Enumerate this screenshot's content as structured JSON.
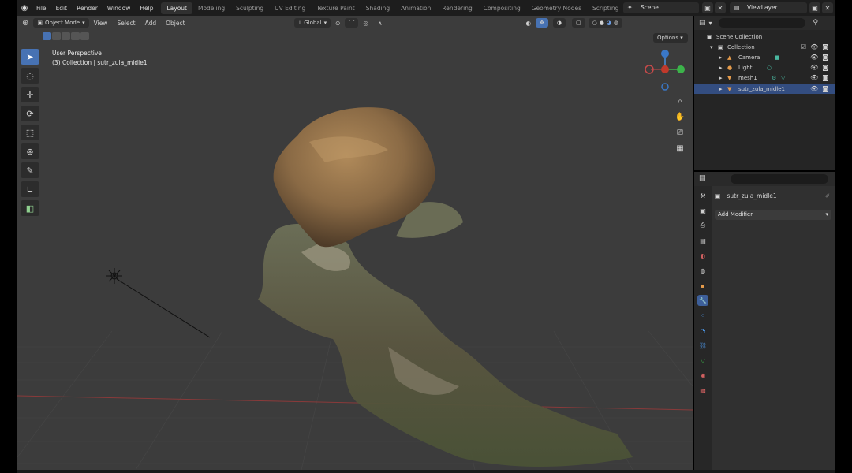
{
  "topbar": {
    "menus": [
      "File",
      "Edit",
      "Render",
      "Window",
      "Help"
    ],
    "workspaces": [
      "Layout",
      "Modeling",
      "Sculpting",
      "UV Editing",
      "Texture Paint",
      "Shading",
      "Animation",
      "Rendering",
      "Compositing",
      "Geometry Nodes",
      "Scripting"
    ],
    "active_workspace": "Layout",
    "scene": "Scene",
    "view_layer": "ViewLayer"
  },
  "viewport": {
    "mode": "Object Mode",
    "menus": [
      "View",
      "Select",
      "Add",
      "Object"
    ],
    "orientation": "Global",
    "options_label": "Options",
    "info_line1": "User Perspective",
    "info_line2": "(3) Collection | sutr_zula_midle1",
    "colors": {
      "bg": "#3c3c3c",
      "grid": "#474747",
      "x_axis": "#8a3a3a",
      "rock": "#8a6a45"
    }
  },
  "outliner": {
    "root": "Scene Collection",
    "collection": "Collection",
    "items": [
      {
        "name": "Camera",
        "icon": "camera-icon"
      },
      {
        "name": "Light",
        "icon": "light-icon"
      },
      {
        "name": "mesh1",
        "icon": "mesh-icon"
      },
      {
        "name": "sutr_zula_midle1",
        "icon": "mesh-icon",
        "selected": true
      }
    ]
  },
  "properties": {
    "object_name": "sutr_zula_midle1",
    "add_modifier_label": "Add Modifier"
  }
}
